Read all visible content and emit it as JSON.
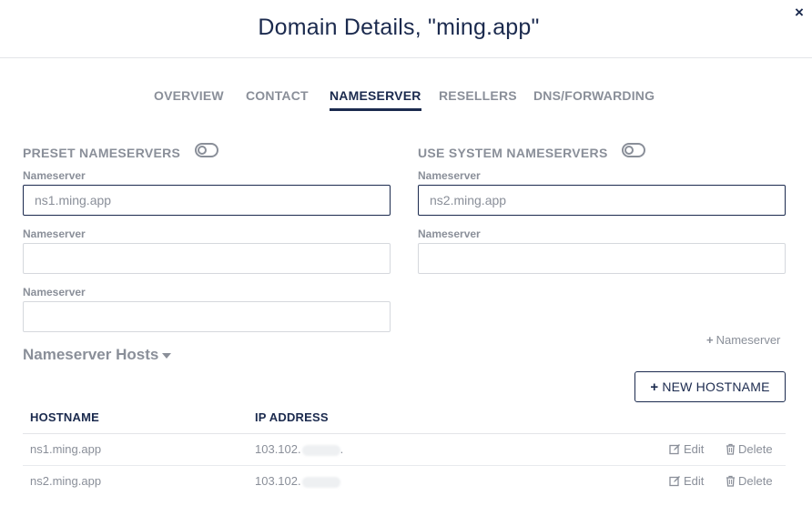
{
  "modal": {
    "title": "Domain Details, \"ming.app\"",
    "close_symbol": "×"
  },
  "tabs": [
    {
      "label": "OVERVIEW",
      "active": false
    },
    {
      "label": "CONTACT",
      "active": false
    },
    {
      "label": "NAMESERVER",
      "active": true
    },
    {
      "label": "RESELLERS",
      "active": false
    },
    {
      "label": "DNS/FORWARDING",
      "active": false
    }
  ],
  "preset": {
    "title": "PRESET NAMESERVERS",
    "fields": [
      {
        "label": "Nameserver",
        "value": "ns1.ming.app"
      },
      {
        "label": "Nameserver",
        "value": ""
      },
      {
        "label": "Nameserver",
        "value": ""
      }
    ]
  },
  "system": {
    "title": "USE SYSTEM NAMESERVERS",
    "fields": [
      {
        "label": "Nameserver",
        "value": "ns2.ming.app"
      },
      {
        "label": "Nameserver",
        "value": ""
      }
    ]
  },
  "add_nameserver": {
    "plus": "+",
    "label": "Nameserver"
  },
  "hosts": {
    "title": "Nameserver Hosts",
    "new_button": {
      "plus": "+",
      "label": "NEW HOSTNAME"
    },
    "columns": {
      "hostname": "HOSTNAME",
      "ip": "IP ADDRESS"
    },
    "rows": [
      {
        "hostname": "ns1.ming.app",
        "ip": "103.102.",
        "ip_suffix": ".",
        "edit": "Edit",
        "delete": "Delete"
      },
      {
        "hostname": "ns2.ming.app",
        "ip": "103.102.",
        "ip_suffix": "",
        "edit": "Edit",
        "delete": "Delete"
      }
    ]
  }
}
